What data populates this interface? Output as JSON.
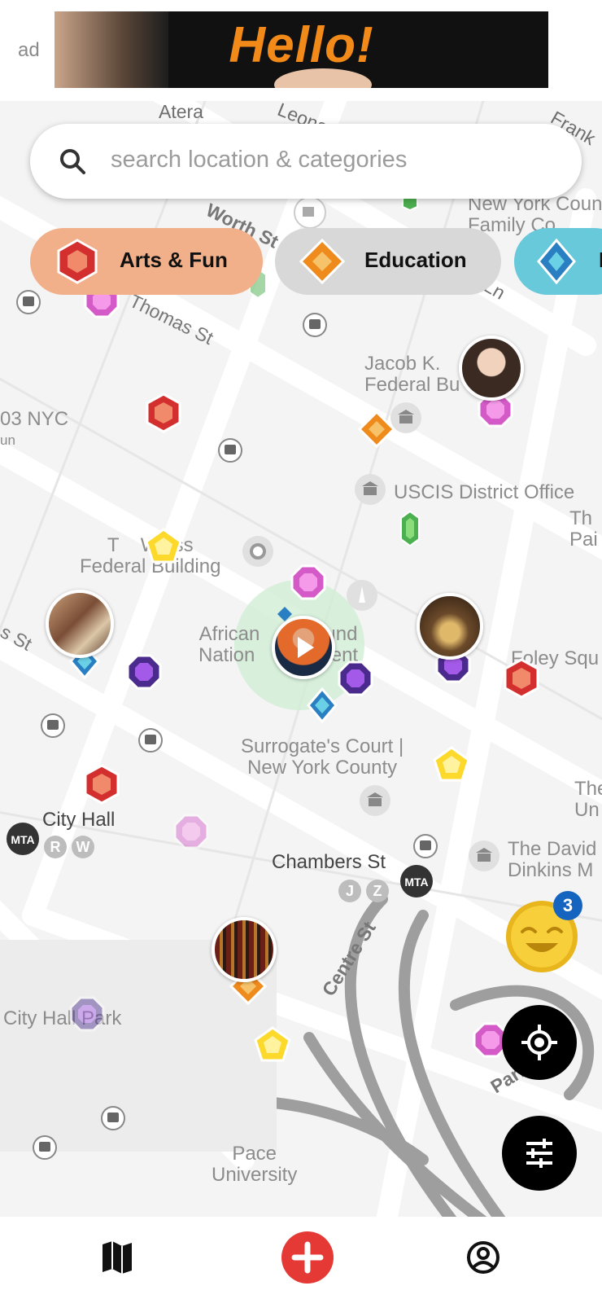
{
  "ad": {
    "label": "ad",
    "banner_text": "Hello!"
  },
  "search": {
    "placeholder": "search location & categories"
  },
  "categories": [
    {
      "label": "Arts & Fun",
      "color": "#f2b08a",
      "icon": "red-hexagon-icon"
    },
    {
      "label": "Education",
      "color": "#d8d8d8",
      "icon": "orange-diamond-icon"
    },
    {
      "label": "E",
      "color": "#68c9da",
      "icon": "blue-diamond-icon"
    }
  ],
  "map_labels": {
    "atera": "Atera",
    "leon": "Leona",
    "frank": "Frank",
    "worth_st": "Worth St",
    "thomas_st": "Thomas St",
    "ny_county_family": "New York County\nFamily Co",
    "ln": "Ln",
    "jacob_k": "Jacob K.\nFederal Bu",
    "nyc_03": "03 NYC",
    "un": "un",
    "uscis": "USCIS District Office",
    "th_pai": "Th\nPai",
    "weiss": "T    Weiss\nFederal Building",
    "african_burial": "African      Ground\nNation       nument",
    "foley": "Foley Squ",
    "s_st": "s St",
    "surrogate": "Surrogate's Court |\nNew York County",
    "the_un": "The\nUn",
    "city_hall": "City Hall",
    "chambers": "Chambers St",
    "david_dinkins": "The David\nDinkins M",
    "centre_st": "Centre St",
    "city_hall_park": "City Hall Park",
    "park_r": "Park R",
    "pace": "Pace\nUniversity"
  },
  "subway": {
    "city_hall_lines": [
      "R",
      "W"
    ],
    "chambers_lines": [
      "J",
      "Z"
    ],
    "mta_label": "MTA"
  },
  "notification_badge": "3",
  "nav": {
    "items": [
      "map-icon",
      "add-icon",
      "profile-icon"
    ],
    "accent": "#e53935"
  }
}
